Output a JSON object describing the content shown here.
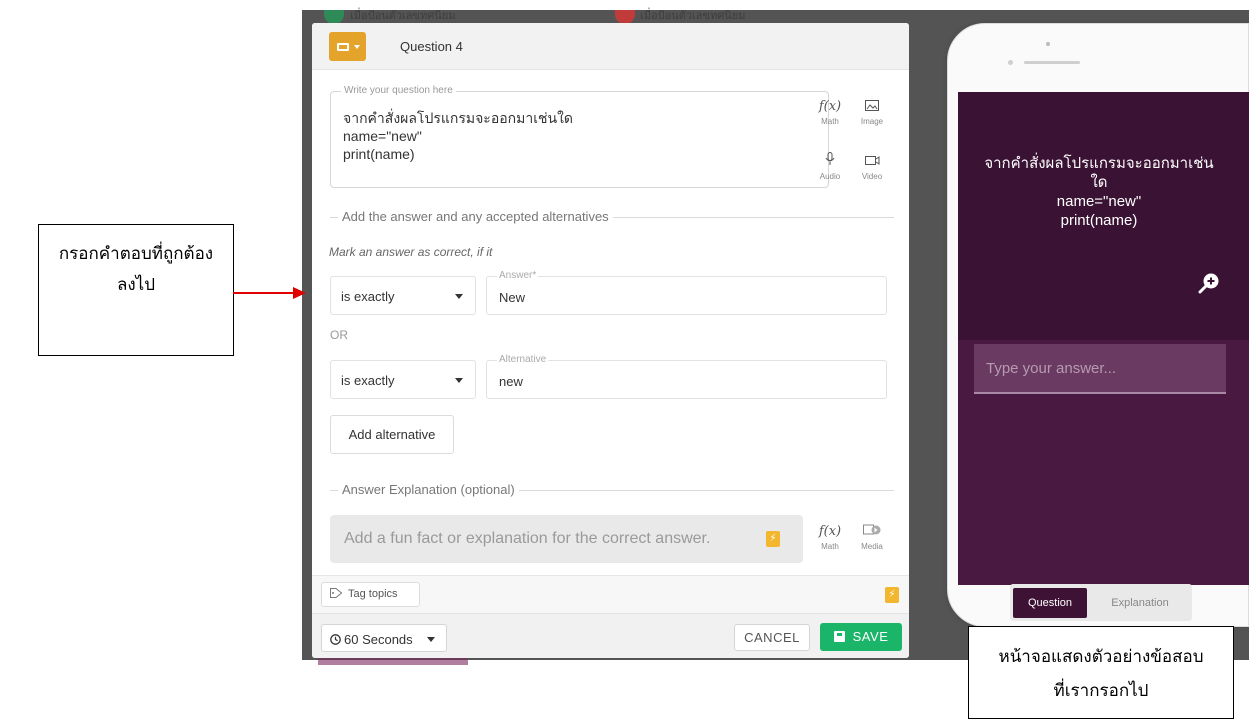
{
  "backdrop": {
    "peek_left_text": "เมื่อป้อนตัวเลขทศนิยม",
    "peek_right_text": "เมื่อป้อนตัวเลขทศนิยม",
    "colors": {
      "peek_left": "#2e8b57",
      "peek_right": "#c23b3b"
    }
  },
  "editor": {
    "question_title": "Question 4",
    "question_legend": "Write your question here",
    "question_text": "จากคำสั่งผลโปรแกรมจะออกมาเช่นใด\nname=\"new\"\nprint(name)",
    "tools": {
      "math_icon": "f(x)",
      "math_label": "Math",
      "image_icon": "image-icon",
      "image_label": "Image",
      "audio_icon": "mic-icon",
      "audio_label": "Audio",
      "video_icon": "video-icon",
      "video_label": "Video"
    },
    "answers_section": "Add the answer and any accepted alternatives",
    "mark_hint": "Mark an answer as correct, if it",
    "answer_rows": [
      {
        "match": "is exactly",
        "legend": "Answer*",
        "value": "New"
      },
      {
        "match": "is exactly",
        "legend": "Alternative",
        "value": "new"
      }
    ],
    "or_label": "OR",
    "add_alternative": "Add alternative",
    "explanation_section": "Answer Explanation (optional)",
    "explanation_placeholder": "Add a fun fact or explanation for the correct answer.",
    "explanation_tools": {
      "math_label": "Math",
      "media_label": "Media"
    },
    "tag_topics": "Tag topics",
    "time_value": "60 Seconds",
    "cancel": "CANCEL",
    "save": "SAVE",
    "colors": {
      "accent": "#e4a32b",
      "save": "#1bb56a"
    }
  },
  "preview": {
    "question_text": "จากคำสั่งผลโปรแกรมจะออกมาเช่น\nใด\nname=\"new\"\nprint(name)",
    "answer_placeholder": "Type your answer...",
    "tab_question": "Question",
    "tab_explanation": "Explanation",
    "colors": {
      "screen": "#4a1942",
      "question_panel": "#3a1234"
    }
  },
  "callouts": {
    "left": "กรอกคำตอบที่ถูกต้อง\nลงไป",
    "right": "หน้าจอแสดงตัวอย่างข้อสอบ\nที่เรากรอกไป",
    "arrow_color": "#e00000"
  }
}
